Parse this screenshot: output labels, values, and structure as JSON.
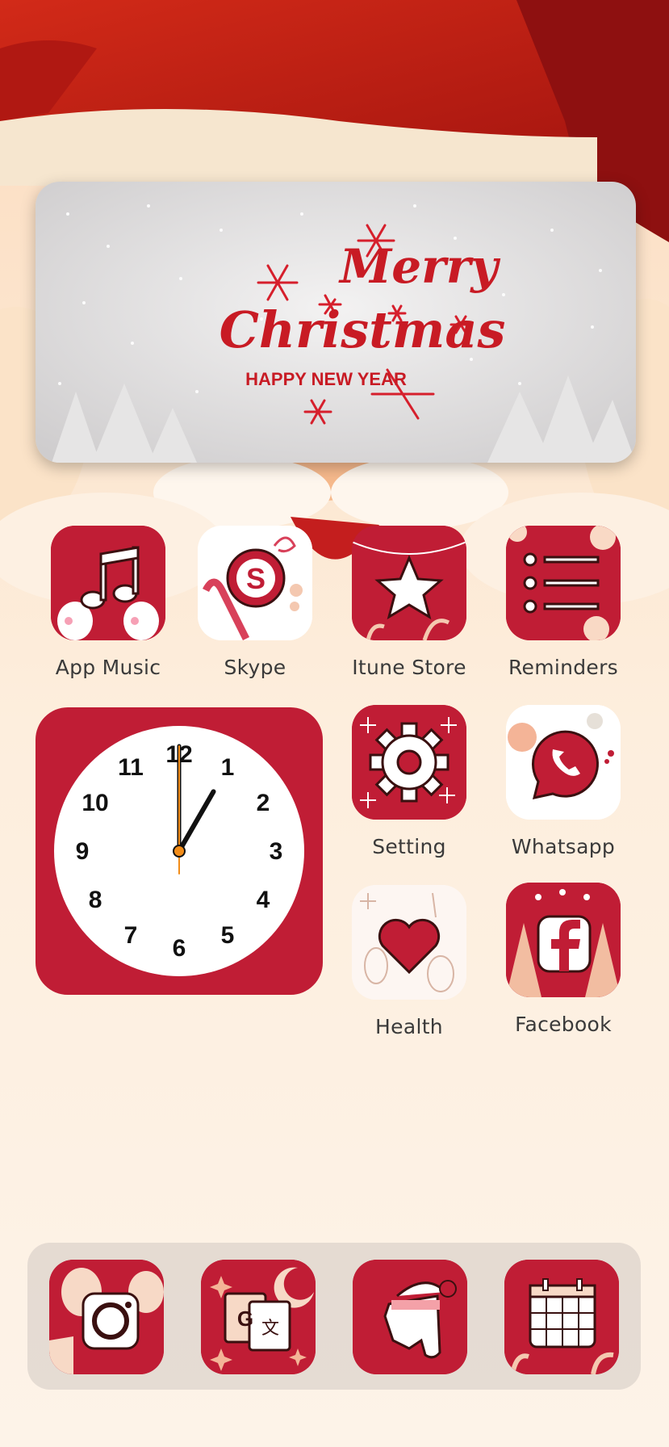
{
  "banner": {
    "title_line1": "Merry",
    "title_line2": "Christmas",
    "subtitle": "HAPPY NEW YEAR"
  },
  "apps_row1": [
    {
      "label": "App Music",
      "icon": "music-note-icon"
    },
    {
      "label": "Skype",
      "icon": "skype-icon"
    },
    {
      "label": "Itune Store",
      "icon": "star-icon"
    },
    {
      "label": "Reminders",
      "icon": "list-icon"
    }
  ],
  "apps_right": [
    {
      "label": "Setting",
      "icon": "gear-icon"
    },
    {
      "label": "Whatsapp",
      "icon": "whatsapp-icon"
    },
    {
      "label": "Health",
      "icon": "heart-icon"
    },
    {
      "label": "Facebook",
      "icon": "facebook-icon"
    }
  ],
  "clock": {
    "numbers": [
      "12",
      "1",
      "2",
      "3",
      "4",
      "5",
      "6",
      "7",
      "8",
      "9",
      "10",
      "11"
    ],
    "hour": 1,
    "minute": 0
  },
  "dock": [
    {
      "icon": "camera-icon"
    },
    {
      "icon": "translate-icon"
    },
    {
      "icon": "evernote-icon"
    },
    {
      "icon": "calendar-icon"
    }
  ],
  "colors": {
    "accent_red": "#c01d35",
    "label_text": "#3a3a3a",
    "background": "#fdf1e4"
  }
}
